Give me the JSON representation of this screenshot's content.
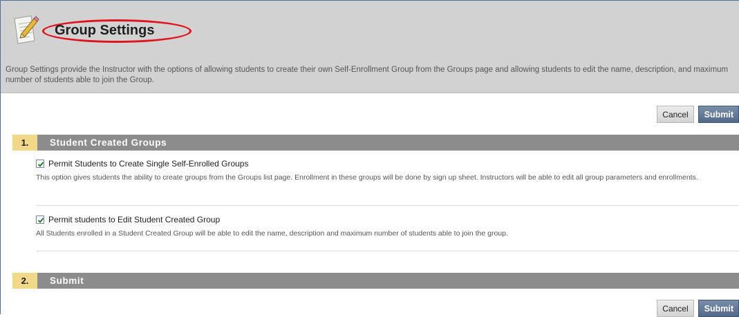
{
  "header": {
    "title": "Group Settings",
    "intro": "Group Settings provide the Instructor with the options of allowing students to create their own Self-Enrollment Group from the Groups page and allowing students to edit the name, description, and maximum number of students able to join the Group.",
    "icon": "pencil-paper-icon",
    "highlight_color": "#e0141d"
  },
  "buttons": {
    "cancel_label": "Cancel",
    "submit_label": "Submit"
  },
  "steps": [
    {
      "number": "1.",
      "title": "Student Created Groups",
      "options": [
        {
          "label": "Permit Students to Create Single Self-Enrolled Groups",
          "checked": true,
          "description": "This option gives students the ability to create groups from the Groups list page. Enrollment in these groups will be done by sign up sheet. Instructors will be able to edit all group parameters and enrollments."
        },
        {
          "label": "Permit students to Edit Student Created Group",
          "checked": true,
          "description": "All Students enrolled in a Student Created Group will be able to edit the name, description and maximum number of students able to join the group."
        }
      ]
    },
    {
      "number": "2.",
      "title": "Submit"
    }
  ],
  "colors": {
    "header_bg": "#d2d2d2",
    "step_bar": "#8c8c8c",
    "step_number_bg": "#f2d98a",
    "submit_bg": "#5f7595"
  }
}
